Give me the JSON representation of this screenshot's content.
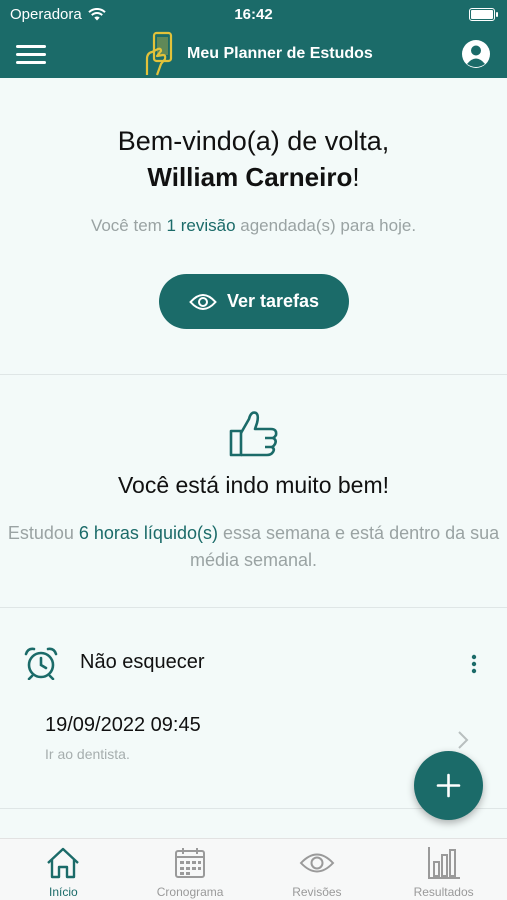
{
  "status_bar": {
    "carrier": "Operadora",
    "time": "16:42"
  },
  "header": {
    "title": "Meu Planner de Estudos",
    "menu_icon": "menu-icon",
    "logo_icon": "phone-hand-icon",
    "profile_icon": "user-circle-icon"
  },
  "welcome": {
    "greeting": "Bem-vindo(a) de volta,",
    "user_name": "William Carneiro",
    "exclamation": "!",
    "sub_prefix": "Você tem ",
    "sub_highlight": "1 revisão",
    "sub_suffix": " agendada(s) para hoje.",
    "button_label": "Ver tarefas"
  },
  "progress": {
    "headline": "Você está indo muito bem!",
    "desc_prefix": "Estudou ",
    "desc_highlight": "6 horas líquido(s)",
    "desc_suffix": " essa semana e está dentro da sua média semanal."
  },
  "reminder": {
    "title": "Não esquecer",
    "items": [
      {
        "datetime": "19/09/2022 09:45",
        "note": "Ir ao dentista."
      }
    ]
  },
  "bottom_nav": [
    {
      "label": "Início",
      "icon": "home-icon",
      "active": true
    },
    {
      "label": "Cronograma",
      "icon": "calendar-icon",
      "active": false
    },
    {
      "label": "Revisões",
      "icon": "eye-icon",
      "active": false
    },
    {
      "label": "Resultados",
      "icon": "bar-chart-icon",
      "active": false
    }
  ],
  "colors": {
    "primary": "#1b6b69",
    "background": "#f3faf9",
    "muted_text": "#9aa3a3",
    "logo_yellow": "#e2c23a"
  }
}
